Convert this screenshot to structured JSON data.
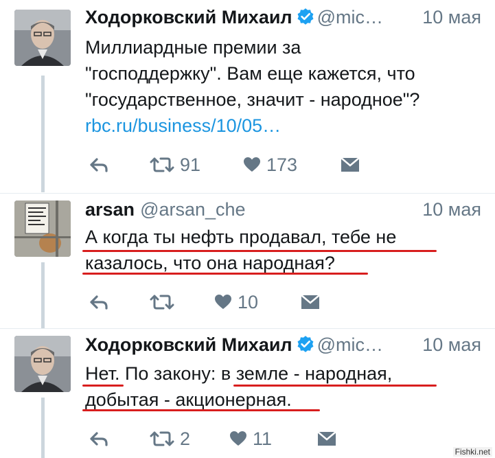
{
  "tweets": [
    {
      "name": "Ходорковский Михаил",
      "handle": "@mic…",
      "date": "10 мая",
      "lines": [
        "Миллиардные премии за",
        "\"господдержку\". Вам еще кажется, что",
        "\"государственное, значит - народное\"?"
      ],
      "link": "rbc.ru/business/10/05…",
      "retweets": "91",
      "likes": "173",
      "verified": true
    },
    {
      "name": "arsan",
      "handle": "@arsan_che",
      "date": "10 мая",
      "lines": [
        "А когда ты нефть продавал, тебе не",
        "казалось, что она народная?"
      ],
      "retweets": "",
      "likes": "10",
      "verified": false
    },
    {
      "name": "Ходорковский Михаил",
      "handle": "@mic…",
      "date": "10 мая",
      "lines": [
        "Нет. По закону: в земле - народная,",
        "добытая - акционерная."
      ],
      "retweets": "2",
      "likes": "11",
      "verified": true
    }
  ],
  "watermark": "Fishki.net",
  "colors": {
    "accent": "#1b95e0",
    "underline": "#d81e1e",
    "muted": "#657786"
  },
  "icons": [
    "reply-icon",
    "retweet-icon",
    "heart-icon",
    "message-icon",
    "verified-icon"
  ]
}
